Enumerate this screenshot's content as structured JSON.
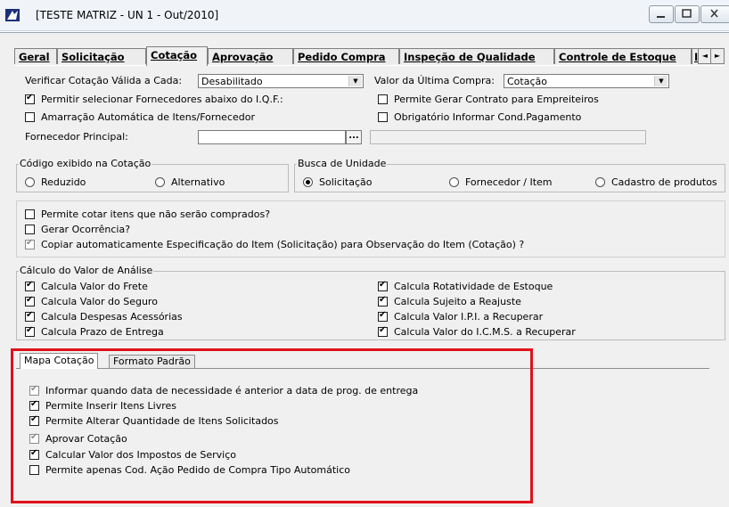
{
  "window": {
    "title": "[TESTE MATRIZ - UN 1 - Out/2010]"
  },
  "main_tabs": [
    {
      "label": "Geral",
      "active": false
    },
    {
      "label": "Solicitação",
      "active": false
    },
    {
      "label": "Cotação",
      "active": true
    },
    {
      "label": "Aprovação",
      "active": false
    },
    {
      "label": "Pedido Compra",
      "active": false
    },
    {
      "label": "Inspeção de Qualidade",
      "active": false
    },
    {
      "label": "Controle de Estoque",
      "active": false
    },
    {
      "label": "In",
      "active": false
    }
  ],
  "tab_scroll": {
    "left": "◄",
    "right": "►"
  },
  "cotacao": {
    "verificar_label": "Verificar Cotação Válida a Cada:",
    "verificar_value": "Desabilitado",
    "valor_ultima_label": "Valor da Última Compra:",
    "valor_ultima_value": "Cotação",
    "checks_top": [
      {
        "label": "Permitir selecionar Fornecedores abaixo do I.Q.F.:",
        "checked": true,
        "disabled": false
      },
      {
        "label": "Permite Gerar Contrato para Empreiteiros",
        "checked": false,
        "disabled": false
      },
      {
        "label": "Amarração Automática de Itens/Fornecedor",
        "checked": false,
        "disabled": false
      },
      {
        "label": "Obrigatório Informar Cond.Pagamento",
        "checked": false,
        "disabled": false
      }
    ],
    "fornecedor_label": "Fornecedor Principal:",
    "fornecedor_value": "",
    "ellipsis": "...",
    "codigo_group": {
      "caption": "Código exibido na Cotação",
      "options": [
        {
          "label": "Reduzido",
          "selected": false
        },
        {
          "label": "Alternativo",
          "selected": false
        }
      ]
    },
    "busca_group": {
      "caption": "Busca de Unidade",
      "options": [
        {
          "label": "Solicitação",
          "selected": true
        },
        {
          "label": "Fornecedor / Item",
          "selected": false
        },
        {
          "label": "Cadastro de produtos",
          "selected": false
        }
      ]
    },
    "checks_mid": [
      {
        "label": "Permite cotar itens que não serão comprados?",
        "checked": false,
        "disabled": false
      },
      {
        "label": "Gerar Ocorrência?",
        "checked": false,
        "disabled": false
      },
      {
        "label": "Copiar automaticamente Especificação do Item (Solicitação) para Observação do Item (Cotação) ?",
        "checked": true,
        "disabled": true
      }
    ],
    "calculo_group": {
      "caption": "Cálculo do Valor de Análise",
      "left": [
        {
          "label": "Calcula Valor do Frete",
          "checked": true
        },
        {
          "label": "Calcula Valor do Seguro",
          "checked": true
        },
        {
          "label": "Calcula Despesas Acessórias",
          "checked": true
        },
        {
          "label": "Calcula Prazo de Entrega",
          "checked": true
        }
      ],
      "right": [
        {
          "label": "Calcula Rotatividade de Estoque",
          "checked": true
        },
        {
          "label": "Calcula Sujeito a Reajuste",
          "checked": true
        },
        {
          "label": "Calcula Valor I.P.I. a Recuperar",
          "checked": true
        },
        {
          "label": "Calcula Valor do I.C.M.S. a Recuperar",
          "checked": true
        }
      ]
    },
    "sub_tabs": [
      {
        "label": "Mapa Cotação",
        "active": true
      },
      {
        "label": "Formato Padrão",
        "active": false
      }
    ],
    "mapa_checks": [
      {
        "label": "Informar quando data de necessidade é anterior a data de prog. de entrega",
        "checked": true,
        "disabled": true
      },
      {
        "label": "Permite Inserir Itens Livres",
        "checked": true,
        "disabled": false
      },
      {
        "label": "Permite Alterar Quantidade de Itens Solicitados",
        "checked": true,
        "disabled": false
      },
      {
        "label": "Aprovar Cotação",
        "checked": true,
        "disabled": true
      },
      {
        "label": "Calcular Valor dos Impostos de Serviço",
        "checked": true,
        "disabled": false
      },
      {
        "label": "Permite apenas Cod. Ação Pedido de Compra Tipo Automático",
        "checked": false,
        "disabled": false
      }
    ]
  },
  "colors": {
    "highlight": "#e0111b",
    "dialog_bg": "#f0f0f0"
  },
  "icons": {
    "app": "app-logo-icon",
    "minimize": "minimize-icon",
    "maximize": "maximize-icon",
    "close": "close-icon"
  }
}
